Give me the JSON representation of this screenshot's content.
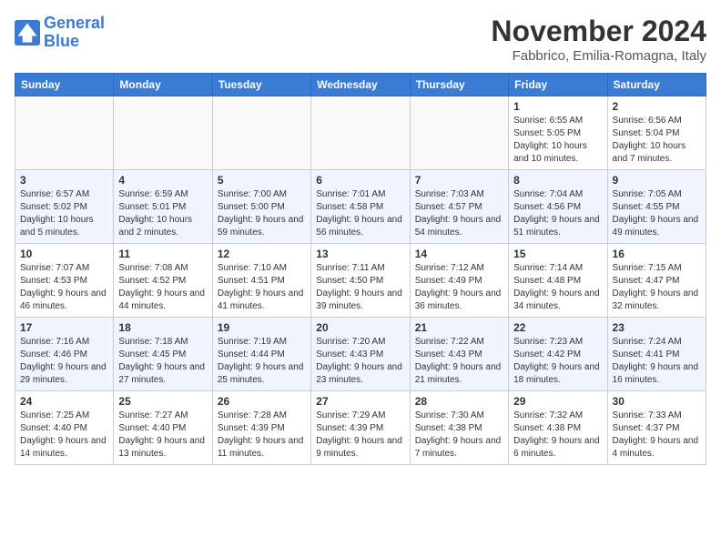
{
  "header": {
    "logo_line1": "General",
    "logo_line2": "Blue",
    "month": "November 2024",
    "location": "Fabbrico, Emilia-Romagna, Italy"
  },
  "weekdays": [
    "Sunday",
    "Monday",
    "Tuesday",
    "Wednesday",
    "Thursday",
    "Friday",
    "Saturday"
  ],
  "weeks": [
    [
      {
        "day": "",
        "info": ""
      },
      {
        "day": "",
        "info": ""
      },
      {
        "day": "",
        "info": ""
      },
      {
        "day": "",
        "info": ""
      },
      {
        "day": "",
        "info": ""
      },
      {
        "day": "1",
        "info": "Sunrise: 6:55 AM\nSunset: 5:05 PM\nDaylight: 10 hours and 10 minutes."
      },
      {
        "day": "2",
        "info": "Sunrise: 6:56 AM\nSunset: 5:04 PM\nDaylight: 10 hours and 7 minutes."
      }
    ],
    [
      {
        "day": "3",
        "info": "Sunrise: 6:57 AM\nSunset: 5:02 PM\nDaylight: 10 hours and 5 minutes."
      },
      {
        "day": "4",
        "info": "Sunrise: 6:59 AM\nSunset: 5:01 PM\nDaylight: 10 hours and 2 minutes."
      },
      {
        "day": "5",
        "info": "Sunrise: 7:00 AM\nSunset: 5:00 PM\nDaylight: 9 hours and 59 minutes."
      },
      {
        "day": "6",
        "info": "Sunrise: 7:01 AM\nSunset: 4:58 PM\nDaylight: 9 hours and 56 minutes."
      },
      {
        "day": "7",
        "info": "Sunrise: 7:03 AM\nSunset: 4:57 PM\nDaylight: 9 hours and 54 minutes."
      },
      {
        "day": "8",
        "info": "Sunrise: 7:04 AM\nSunset: 4:56 PM\nDaylight: 9 hours and 51 minutes."
      },
      {
        "day": "9",
        "info": "Sunrise: 7:05 AM\nSunset: 4:55 PM\nDaylight: 9 hours and 49 minutes."
      }
    ],
    [
      {
        "day": "10",
        "info": "Sunrise: 7:07 AM\nSunset: 4:53 PM\nDaylight: 9 hours and 46 minutes."
      },
      {
        "day": "11",
        "info": "Sunrise: 7:08 AM\nSunset: 4:52 PM\nDaylight: 9 hours and 44 minutes."
      },
      {
        "day": "12",
        "info": "Sunrise: 7:10 AM\nSunset: 4:51 PM\nDaylight: 9 hours and 41 minutes."
      },
      {
        "day": "13",
        "info": "Sunrise: 7:11 AM\nSunset: 4:50 PM\nDaylight: 9 hours and 39 minutes."
      },
      {
        "day": "14",
        "info": "Sunrise: 7:12 AM\nSunset: 4:49 PM\nDaylight: 9 hours and 36 minutes."
      },
      {
        "day": "15",
        "info": "Sunrise: 7:14 AM\nSunset: 4:48 PM\nDaylight: 9 hours and 34 minutes."
      },
      {
        "day": "16",
        "info": "Sunrise: 7:15 AM\nSunset: 4:47 PM\nDaylight: 9 hours and 32 minutes."
      }
    ],
    [
      {
        "day": "17",
        "info": "Sunrise: 7:16 AM\nSunset: 4:46 PM\nDaylight: 9 hours and 29 minutes."
      },
      {
        "day": "18",
        "info": "Sunrise: 7:18 AM\nSunset: 4:45 PM\nDaylight: 9 hours and 27 minutes."
      },
      {
        "day": "19",
        "info": "Sunrise: 7:19 AM\nSunset: 4:44 PM\nDaylight: 9 hours and 25 minutes."
      },
      {
        "day": "20",
        "info": "Sunrise: 7:20 AM\nSunset: 4:43 PM\nDaylight: 9 hours and 23 minutes."
      },
      {
        "day": "21",
        "info": "Sunrise: 7:22 AM\nSunset: 4:43 PM\nDaylight: 9 hours and 21 minutes."
      },
      {
        "day": "22",
        "info": "Sunrise: 7:23 AM\nSunset: 4:42 PM\nDaylight: 9 hours and 18 minutes."
      },
      {
        "day": "23",
        "info": "Sunrise: 7:24 AM\nSunset: 4:41 PM\nDaylight: 9 hours and 16 minutes."
      }
    ],
    [
      {
        "day": "24",
        "info": "Sunrise: 7:25 AM\nSunset: 4:40 PM\nDaylight: 9 hours and 14 minutes."
      },
      {
        "day": "25",
        "info": "Sunrise: 7:27 AM\nSunset: 4:40 PM\nDaylight: 9 hours and 13 minutes."
      },
      {
        "day": "26",
        "info": "Sunrise: 7:28 AM\nSunset: 4:39 PM\nDaylight: 9 hours and 11 minutes."
      },
      {
        "day": "27",
        "info": "Sunrise: 7:29 AM\nSunset: 4:39 PM\nDaylight: 9 hours and 9 minutes."
      },
      {
        "day": "28",
        "info": "Sunrise: 7:30 AM\nSunset: 4:38 PM\nDaylight: 9 hours and 7 minutes."
      },
      {
        "day": "29",
        "info": "Sunrise: 7:32 AM\nSunset: 4:38 PM\nDaylight: 9 hours and 6 minutes."
      },
      {
        "day": "30",
        "info": "Sunrise: 7:33 AM\nSunset: 4:37 PM\nDaylight: 9 hours and 4 minutes."
      }
    ]
  ]
}
